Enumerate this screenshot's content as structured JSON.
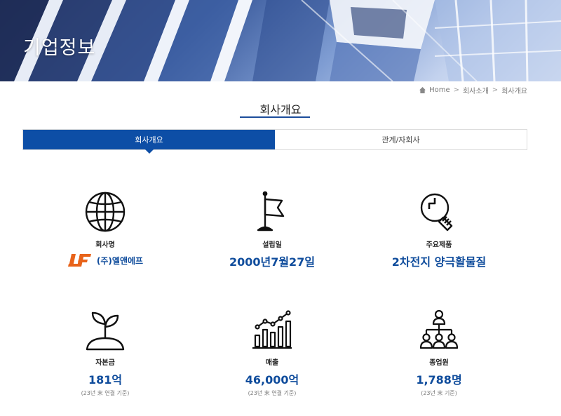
{
  "hero": {
    "title": "기업정보"
  },
  "breadcrumb": {
    "home": "Home",
    "sep": ">",
    "level1": "회사소개",
    "level2": "회사개요"
  },
  "section": {
    "title": "회사개요"
  },
  "tabs": [
    {
      "label": "회사개요",
      "active": true
    },
    {
      "label": "관계/자회사",
      "active": false
    }
  ],
  "colors": {
    "accent": "#0d4ea6",
    "value_text": "#0f4c9c",
    "logo_orange": "#e8631a"
  },
  "info": {
    "company": {
      "icon": "globe-icon",
      "label": "회사명",
      "logo_text": "(주)엘앤에프"
    },
    "founded": {
      "icon": "flag-icon",
      "label": "설립일",
      "value": "2000년7월27일"
    },
    "product": {
      "icon": "lightbulb-icon",
      "label": "주요제품",
      "value": "2차전지 양극활물질"
    },
    "capital": {
      "icon": "sprout-icon",
      "label": "자본금",
      "value": "181억",
      "note": "(23년 末 연결 기준)"
    },
    "sales": {
      "icon": "growth-chart-icon",
      "label": "매출",
      "value": "46,000억",
      "note": "(23년 末 연결 기준)"
    },
    "employees": {
      "icon": "org-chart-icon",
      "label": "종업원",
      "value": "1,788명",
      "note": "(23년 末 기준)"
    }
  }
}
